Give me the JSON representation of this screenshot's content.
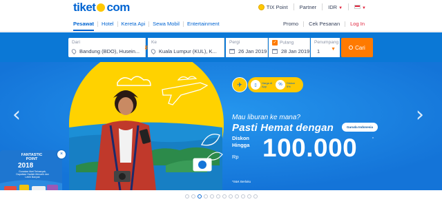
{
  "brand": {
    "logo_left": "tiket",
    "logo_right": "com"
  },
  "topbar": {
    "tix_point": "TIX Point",
    "partner": "Partner",
    "currency": "IDR"
  },
  "nav": {
    "left": [
      "Pesawat",
      "Hotel",
      "Kereta Api",
      "Sewa Mobil",
      "Entertainment"
    ],
    "right": [
      "Promo",
      "Cek Pesanan",
      "Log In"
    ]
  },
  "search": {
    "from_label": "Dari",
    "from_value": "Bandung (BDO), Husein...",
    "to_label": "Ke",
    "to_value": "Kuala Lumpur (KUL), K...",
    "depart_label": "Pergi",
    "depart_value": "26 Jan 2019",
    "return_label": "Pulang",
    "return_value": "28 Jan 2019",
    "pax_label": "Penumpang",
    "pax_value": "1",
    "search_button": "Cari"
  },
  "hero": {
    "badge_1": "Harga di App",
    "badge_2": "Diskon 5%",
    "line1": "Mau liburan ke mana?",
    "line2": "Pasti Hemat dengan",
    "airline": "Garuda Indonesia",
    "diskon_line1": "Diskon",
    "diskon_line2": "Hingga",
    "currency": "Rp",
    "amount": "100.000",
    "asterisk": "*",
    "tc": "*S&K Berlaku"
  },
  "promo_card": {
    "title_line1": "FANTASTIC",
    "title_line2": "POINT",
    "year": "2018",
    "desc": "Gunakan tiket Terbanyak, Dapatkan Hadiah Menarik dan Lebih Banyak"
  },
  "carousel": {
    "slide_count": 12,
    "active_index": 2
  },
  "colors": {
    "brand_blue": "#0064d2",
    "search_band": "#0b78d6",
    "accent_orange": "#ff7a00",
    "sun_yellow": "#ffc800",
    "login_red": "#e0233c"
  }
}
